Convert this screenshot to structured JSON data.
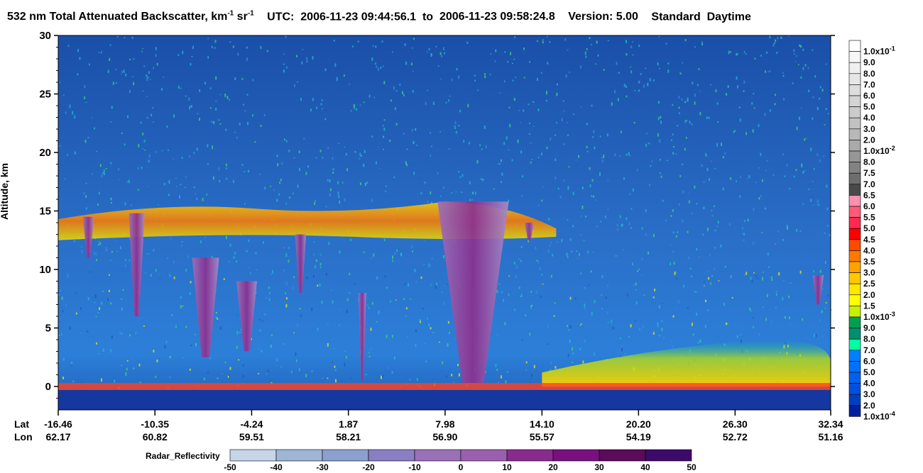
{
  "title": {
    "product": "532 nm Total Attenuated Backscatter, km",
    "unit_exp1": "-1",
    "sr": " sr",
    "unit_exp2": "-1",
    "utc_label": "UTC:",
    "start": "2006-11-23 09:44:56.1",
    "to": "to",
    "end": "2006-11-23 09:58:24.8",
    "version": "Version: 5.00",
    "mode": "Standard",
    "time_of_day": "Daytime"
  },
  "chart_data": [
    {
      "type": "heatmap",
      "name_hint": "lidar backscatter curtain",
      "ylabel": "Altitude, km",
      "ylim": [
        -2,
        30
      ],
      "yticks": [
        0,
        5,
        10,
        15,
        20,
        25,
        30
      ],
      "x_rows": {
        "lat_label": "Lat",
        "lon_label": "Lon",
        "lat": [
          "-16.46",
          "-10.35",
          "-4.24",
          "1.87",
          "7.98",
          "14.10",
          "20.20",
          "26.30",
          "32.34"
        ],
        "lon": [
          "62.17",
          "60.82",
          "59.51",
          "58.21",
          "56.90",
          "55.57",
          "54.19",
          "52.72",
          "51.16"
        ]
      },
      "features": [
        {
          "kind": "cirrus_layer",
          "lat_range": [
            -16.46,
            15.0
          ],
          "altitude_km": [
            12,
            16
          ]
        },
        {
          "kind": "radar_echo_column",
          "lat_range": [
            7.5,
            12.0
          ],
          "altitude_km": [
            0,
            16
          ]
        },
        {
          "kind": "surface_return",
          "altitude_km": 0
        },
        {
          "kind": "boundary_layer_aerosol",
          "lat_range": [
            14.1,
            32.34
          ],
          "altitude_km": [
            0,
            3
          ]
        }
      ]
    },
    {
      "type": "colorbar",
      "name_hint": "backscatter color scale",
      "labels": [
        "1.0x10-1",
        "9.0",
        "8.0",
        "7.0",
        "6.0",
        "5.0",
        "4.0",
        "3.0",
        "2.0",
        "1.0x10-2",
        "8.0",
        "7.5",
        "7.0",
        "6.5",
        "6.0",
        "5.5",
        "5.0",
        "4.5",
        "4.0",
        "3.5",
        "3.0",
        "2.5",
        "2.0",
        "1.5",
        "1.0x10-3",
        "9.0",
        "8.0",
        "7.0",
        "6.0",
        "5.0",
        "4.0",
        "3.0",
        "2.0",
        "1.0x10-4"
      ],
      "colors": [
        "#ffffff",
        "#f7f7f7",
        "#efefef",
        "#e6e6e6",
        "#dddddd",
        "#d4d4d4",
        "#cbcbcb",
        "#c2c2c2",
        "#b8b8b8",
        "#aaaaaa",
        "#969696",
        "#828282",
        "#6e6e6e",
        "#4a4a4a",
        "#ff8fb0",
        "#ff5a78",
        "#ff2a50",
        "#ff0000",
        "#ff4a00",
        "#ff7a00",
        "#ffa200",
        "#ffc800",
        "#ffe800",
        "#ffff00",
        "#c8f000",
        "#00a050",
        "#009070",
        "#00ffa0",
        "#0080ff",
        "#0070ff",
        "#0060f0",
        "#0050e0",
        "#0040c0",
        "#0020a0"
      ]
    },
    {
      "type": "colorbar",
      "name_hint": "radar reflectivity scale",
      "title": "Radar_Reflectivity",
      "ticks": [
        "-50",
        "-40",
        "-30",
        "-20",
        "-10",
        "0",
        "10",
        "20",
        "30",
        "40",
        "50"
      ],
      "colors": [
        "#c6d5e8",
        "#9fb5d6",
        "#8c9fcf",
        "#8a7ec4",
        "#9a70b8",
        "#9b5fb0",
        "#8a2a90",
        "#7a1080",
        "#5c0a5a",
        "#3c0a6a"
      ]
    }
  ]
}
